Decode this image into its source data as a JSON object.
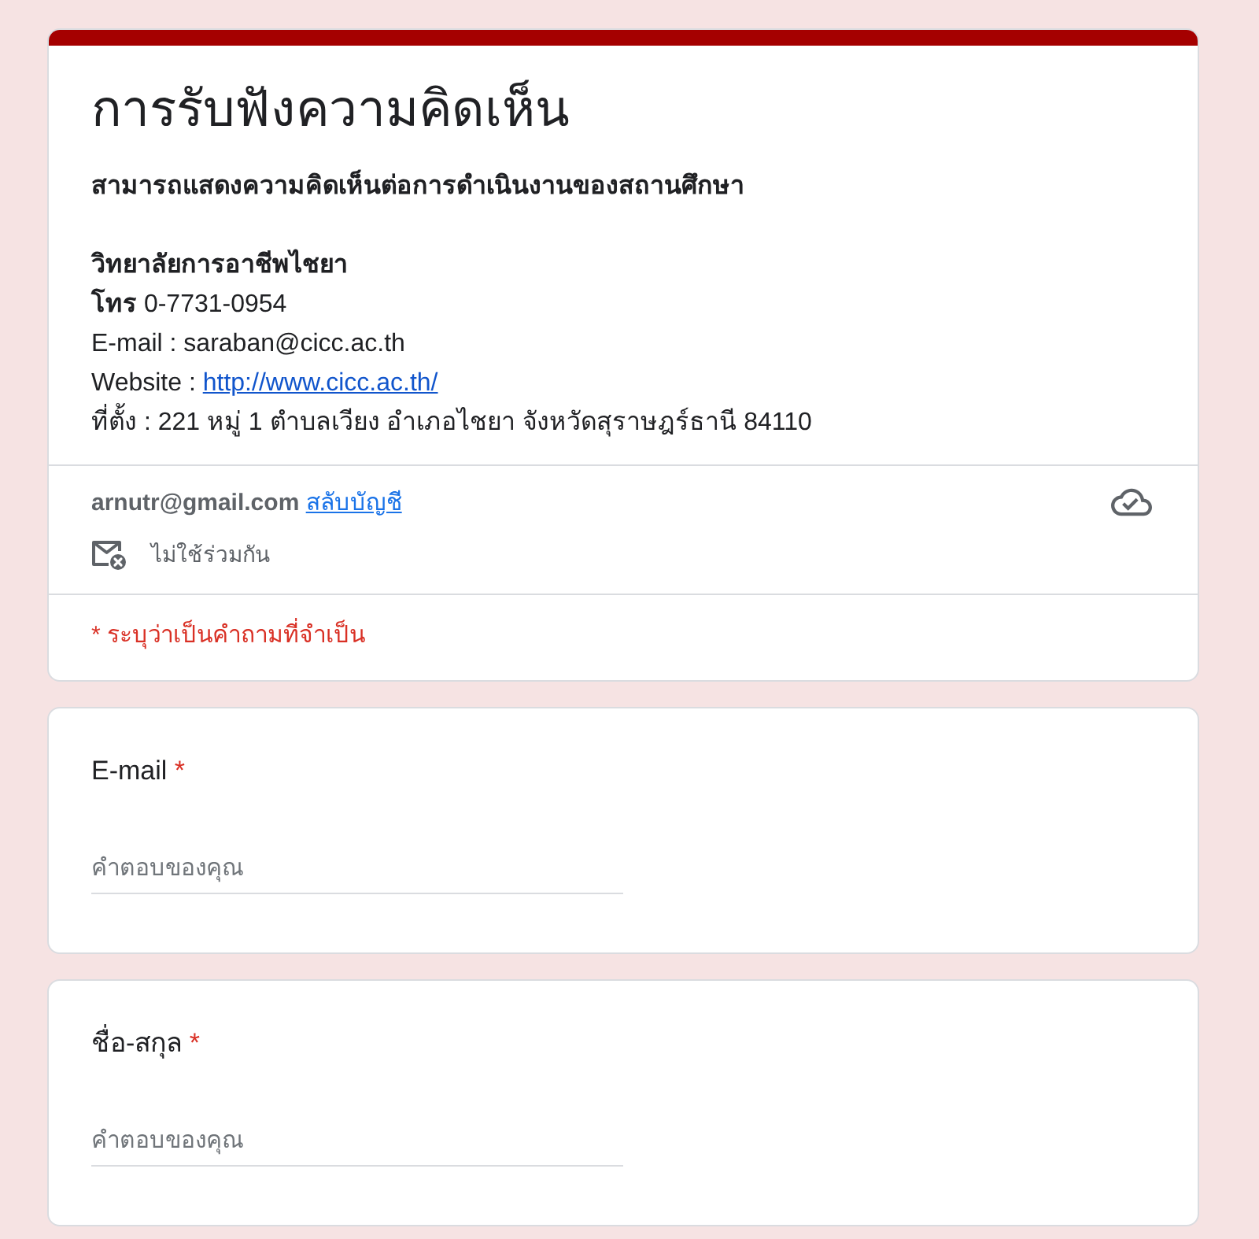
{
  "form": {
    "title": "การรับฟังความคิดเห็น",
    "description": [
      {
        "lines": [
          {
            "text": "สามารถแสดงความคิดเห็นต่อการดำเนินงานของสถานศึกษา",
            "bold": true
          }
        ]
      },
      {
        "lines": [
          {
            "text": "วิทยาลัยการอาชีพไชยา",
            "bold": true
          },
          {
            "text": "**โทร** 0-7731-0954",
            "bold": false
          },
          {
            "text": "E-mail : saraban@cicc.ac.th",
            "bold": false
          },
          {
            "text": "Website :",
            "bold": false,
            "link": "http://www.cicc.ac.th/"
          },
          {
            "text": "ที่ตั้ง : 221 หมู่ 1 ตำบลเวียง อำเภอไชยา จังหวัดสุราษฎร์ธานี 84110",
            "bold": false
          }
        ]
      }
    ]
  },
  "account": {
    "email": "arnutr@gmail.com",
    "switch_link": "สลับบัญชี",
    "sharing_note": "ไม่ใช้ร่วมกัน"
  },
  "required_note": "* ระบุว่าเป็นคำถามที่จำเป็น",
  "questions": [
    {
      "title": "E-mail",
      "required_mark": "*",
      "placeholder": "คำตอบของคุณ"
    },
    {
      "title": "ชื่อ-สกุล",
      "required_mark": "*",
      "placeholder": "คำตอบของคุณ"
    }
  ]
}
